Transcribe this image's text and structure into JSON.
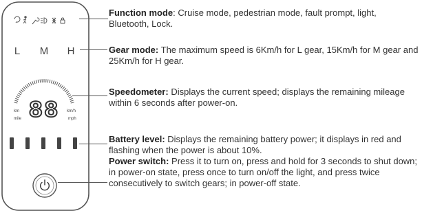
{
  "device": {
    "status_icons": [
      "cruise-icon",
      "pedestrian-icon",
      "fault-wrench-icon",
      "headlight-icon",
      "bluetooth-icon",
      "lock-icon"
    ],
    "gears": [
      "L",
      "M",
      "H"
    ],
    "speed_digits": "88",
    "unit_km": "km",
    "unit_mile": "mile",
    "unit_kmh": "km/h",
    "unit_mph": "mph",
    "battery_segments": 5
  },
  "callouts": [
    {
      "title": "Function mode",
      "sep": ": ",
      "text": "Cruise mode, pedestrian mode, fault prompt, light, Bluetooth, Lock."
    },
    {
      "title": "Gear mode:",
      "sep": " ",
      "text": "The maximum speed is 6Km/h for L gear, 15Km/h for M gear and 25Km/h for H gear."
    },
    {
      "title": "Speedometer:",
      "sep": " ",
      "text": "Displays the current speed; displays the remaining mileage within 6 seconds after power-on."
    },
    {
      "title": "Battery level:",
      "sep": " ",
      "text": "Displays the remaining battery power; it displays in red and flashing when the power is about 10%."
    },
    {
      "title": "Power switch:",
      "sep": " ",
      "text": "Press it to turn on, press and hold for 3 seconds to shut down; in power-on state, press once to turn on/off the light, and press twice consecutively to switch gears; in power-off state."
    }
  ]
}
